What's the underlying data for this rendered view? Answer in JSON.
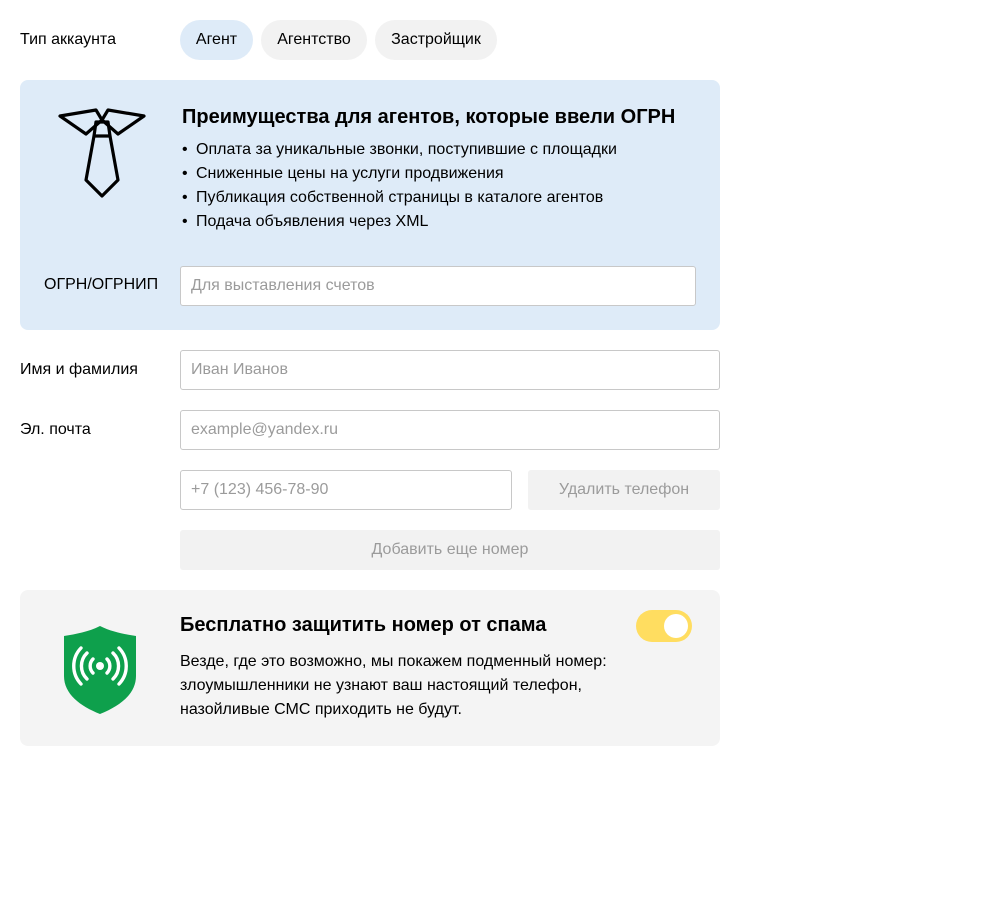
{
  "account_type": {
    "label": "Тип аккаунта",
    "options": [
      "Агент",
      "Агентство",
      "Застройщик"
    ],
    "selected": "Агент"
  },
  "benefits": {
    "icon": "tie-icon",
    "title": "Преимущества для агентов, которые ввели ОГРН",
    "items": [
      "Оплата за уникальные звонки, поступившие с площадки",
      "Сниженные цены на услуги продвижения",
      "Публикация собственной страницы в каталоге агентов",
      "Подача объявления через XML"
    ],
    "ogrn_label": "ОГРН/ОГРНИП",
    "ogrn_placeholder": "Для выставления счетов",
    "ogrn_value": ""
  },
  "form": {
    "name_label": "Имя и фамилия",
    "name_placeholder": "Иван Иванов",
    "name_value": "",
    "email_label": "Эл. почта",
    "email_placeholder": "example@yandex.ru",
    "email_value": "",
    "phone_placeholder": "+7 (123) 456-78-90",
    "phone_value": "",
    "delete_phone_label": "Удалить телефон",
    "add_phone_label": "Добавить еще номер"
  },
  "spam_protection": {
    "icon": "shield-signal-icon",
    "title": "Бесплатно защитить номер от спама",
    "description": "Везде, где это возможно, мы покажем подменный номер: злоумышленники не узнают ваш настоящий телефон, назойливые СМС приходить не будут.",
    "enabled": true
  },
  "colors": {
    "selected_chip": "#deebf8",
    "chip": "#f2f2f2",
    "benefits_bg": "#deebf8",
    "spam_bg": "#f4f4f4",
    "toggle_on": "#ffdd60",
    "shield_green": "#0ea04c"
  }
}
